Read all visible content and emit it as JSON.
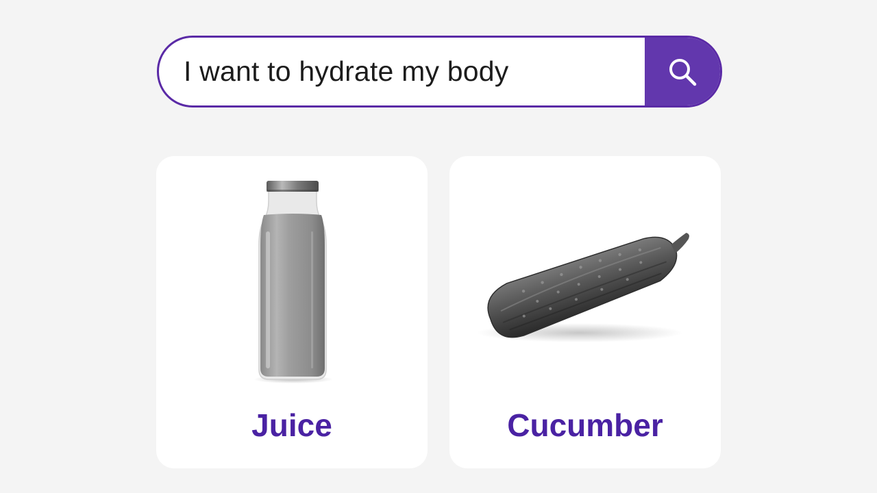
{
  "search": {
    "query": "I want to hydrate my body",
    "button_icon": "search-icon",
    "accent_color": "#6237ad",
    "border_color": "#5a2aa6"
  },
  "results": [
    {
      "label": "Juice",
      "image_icon": "juice-bottle-image"
    },
    {
      "label": "Cucumber",
      "image_icon": "cucumber-image"
    }
  ],
  "colors": {
    "label_color": "#4a22a3",
    "background": "#f4f4f4",
    "card_background": "#ffffff"
  }
}
